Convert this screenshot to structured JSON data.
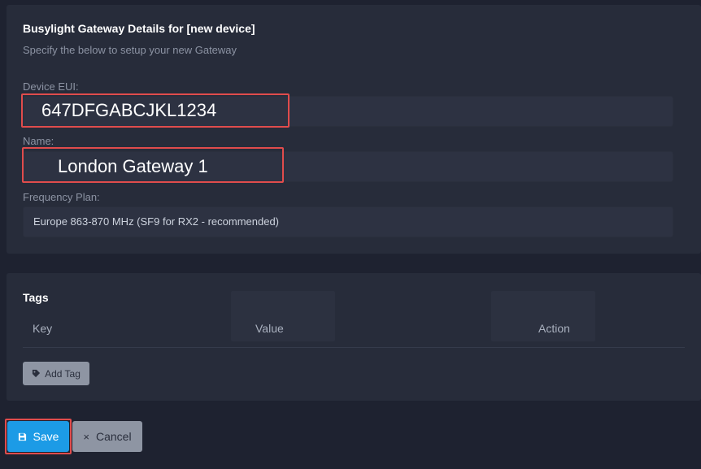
{
  "gateway_card": {
    "title": "Busylight Gateway Details for [new device]",
    "subtitle": "Specify the below to setup your new Gateway",
    "device_eui": {
      "label": "Device EUI:",
      "value": "647DFGABCJKL1234"
    },
    "name": {
      "label": "Name:",
      "value": "London Gateway 1"
    },
    "frequency_plan": {
      "label": "Frequency Plan:",
      "value": "Europe 863-870 MHz (SF9 for RX2 - recommended)"
    }
  },
  "tags_card": {
    "title": "Tags",
    "columns": [
      "Key",
      "Value",
      "Action"
    ],
    "add_tag_label": "Add Tag",
    "add_tag_icon": "tag-icon"
  },
  "actions": {
    "save_label": "Save",
    "save_icon": "floppy-disk-icon",
    "cancel_label": "Cancel",
    "cancel_icon": "close-icon"
  },
  "colors": {
    "background": "#1e2230",
    "card": "#272c3a",
    "primary": "#1c9be6",
    "highlight": "#e04c4c"
  }
}
